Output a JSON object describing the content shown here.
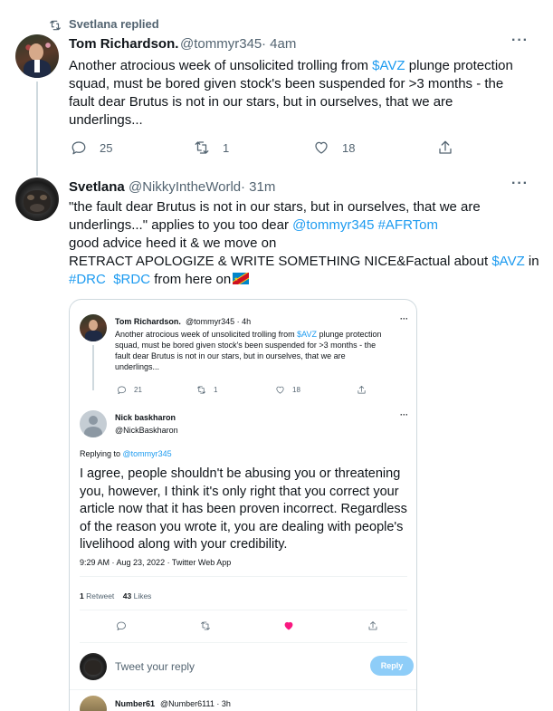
{
  "context": {
    "replied_label": "Svetlana replied"
  },
  "tweet1": {
    "name": "Tom Richardson.",
    "handle": "@tommyr345",
    "time": "· 4am",
    "text_a": "Another atrocious week of unsolicited trolling from ",
    "cashtag": "$AVZ",
    "text_b": " plunge protection squad, must be bored given stock's been suspended for >3 months - the fault dear Brutus is not in our stars, but in ourselves, that we are underlings...",
    "replies": "25",
    "retweets": "1",
    "likes": "18"
  },
  "tweet2": {
    "name": "Svetlana",
    "handle": "@NikkyIntheWorld",
    "time": "· 31m",
    "line1": "\"the fault dear Brutus is not in our stars, but in ourselves, that we are",
    "line2a": "underlings...\" applies to you too dear ",
    "mention": "@tommyr345",
    "hashtag": "#AFRTom",
    "line3": "good advice heed it & we move on",
    "line4a": "RETRACT APOLOGIZE & WRITE SOMETHING NICE&Factual about ",
    "cashtag": "$AVZ",
    "line4b": " in",
    "tag_drc": "#DRC",
    "tag_rdc": "$RDC",
    "line5b": " from here on"
  },
  "embed": {
    "t1_name": "Tom Richardson.",
    "t1_handle": "@tommyr345 · 4h",
    "t1_l1a": "Another atrocious week of unsolicited trolling from ",
    "t1_cashtag": "$AVZ",
    "t1_l1b": " plunge protection",
    "t1_l2": "squad, must be bored given stock's been suspended for >3 months - the",
    "t1_l3": "fault dear Brutus is not in our stars, but in ourselves, that we are",
    "t1_l4": "underlings...",
    "t1_replies": "21",
    "t1_retweets": "1",
    "t1_likes": "18",
    "t2_name": "Nick baskharon",
    "t2_handle": "@NickBaskharon",
    "replying_to_label": "Replying to ",
    "replying_to_handle": "@tommyr345",
    "t2_text": "I agree, people shouldn't be abusing you or threatening you, however, I think it's only right that you correct your article now that it has been proven incorrect. Regardless of the reason you wrote it, you are dealing with people's livelihood along with your credibility.",
    "t2_meta": "9:29 AM · Aug 23, 2022 · Twitter Web App",
    "t2_retweets_count": "1",
    "t2_retweets_label": "Retweet",
    "t2_likes_count": "43",
    "t2_likes_label": "Likes",
    "reply_placeholder": "Tweet your reply",
    "reply_button": "Reply",
    "t3_name": "Number61",
    "t3_handle": "@Number6111 · 3h"
  },
  "colors": {
    "link": "#1d9bf0",
    "like_active": "#f91880",
    "muted": "#536471"
  }
}
